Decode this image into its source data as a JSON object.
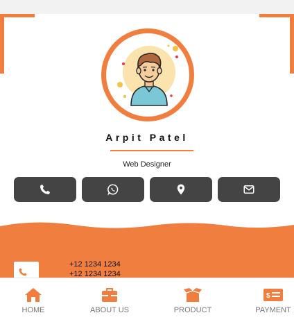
{
  "profile": {
    "name": "Arpit Patel",
    "title": "Web Designer"
  },
  "actions": [
    {
      "icon": "phone-icon"
    },
    {
      "icon": "whatsapp-icon"
    },
    {
      "icon": "location-pin-icon"
    },
    {
      "icon": "envelope-icon"
    }
  ],
  "contact": {
    "phones": [
      "+12 1234 1234",
      "+12 1234 1234"
    ]
  },
  "nav": {
    "items": [
      {
        "label": "HOME",
        "icon": "home-icon"
      },
      {
        "label": "ABOUT US",
        "icon": "briefcase-icon"
      },
      {
        "label": "PRODUCT",
        "icon": "box-icon"
      },
      {
        "label": "PAYMENT",
        "icon": "money-icon"
      }
    ]
  },
  "colors": {
    "accent": "#f07e3f",
    "button": "#444444",
    "nav_label": "#777777"
  }
}
